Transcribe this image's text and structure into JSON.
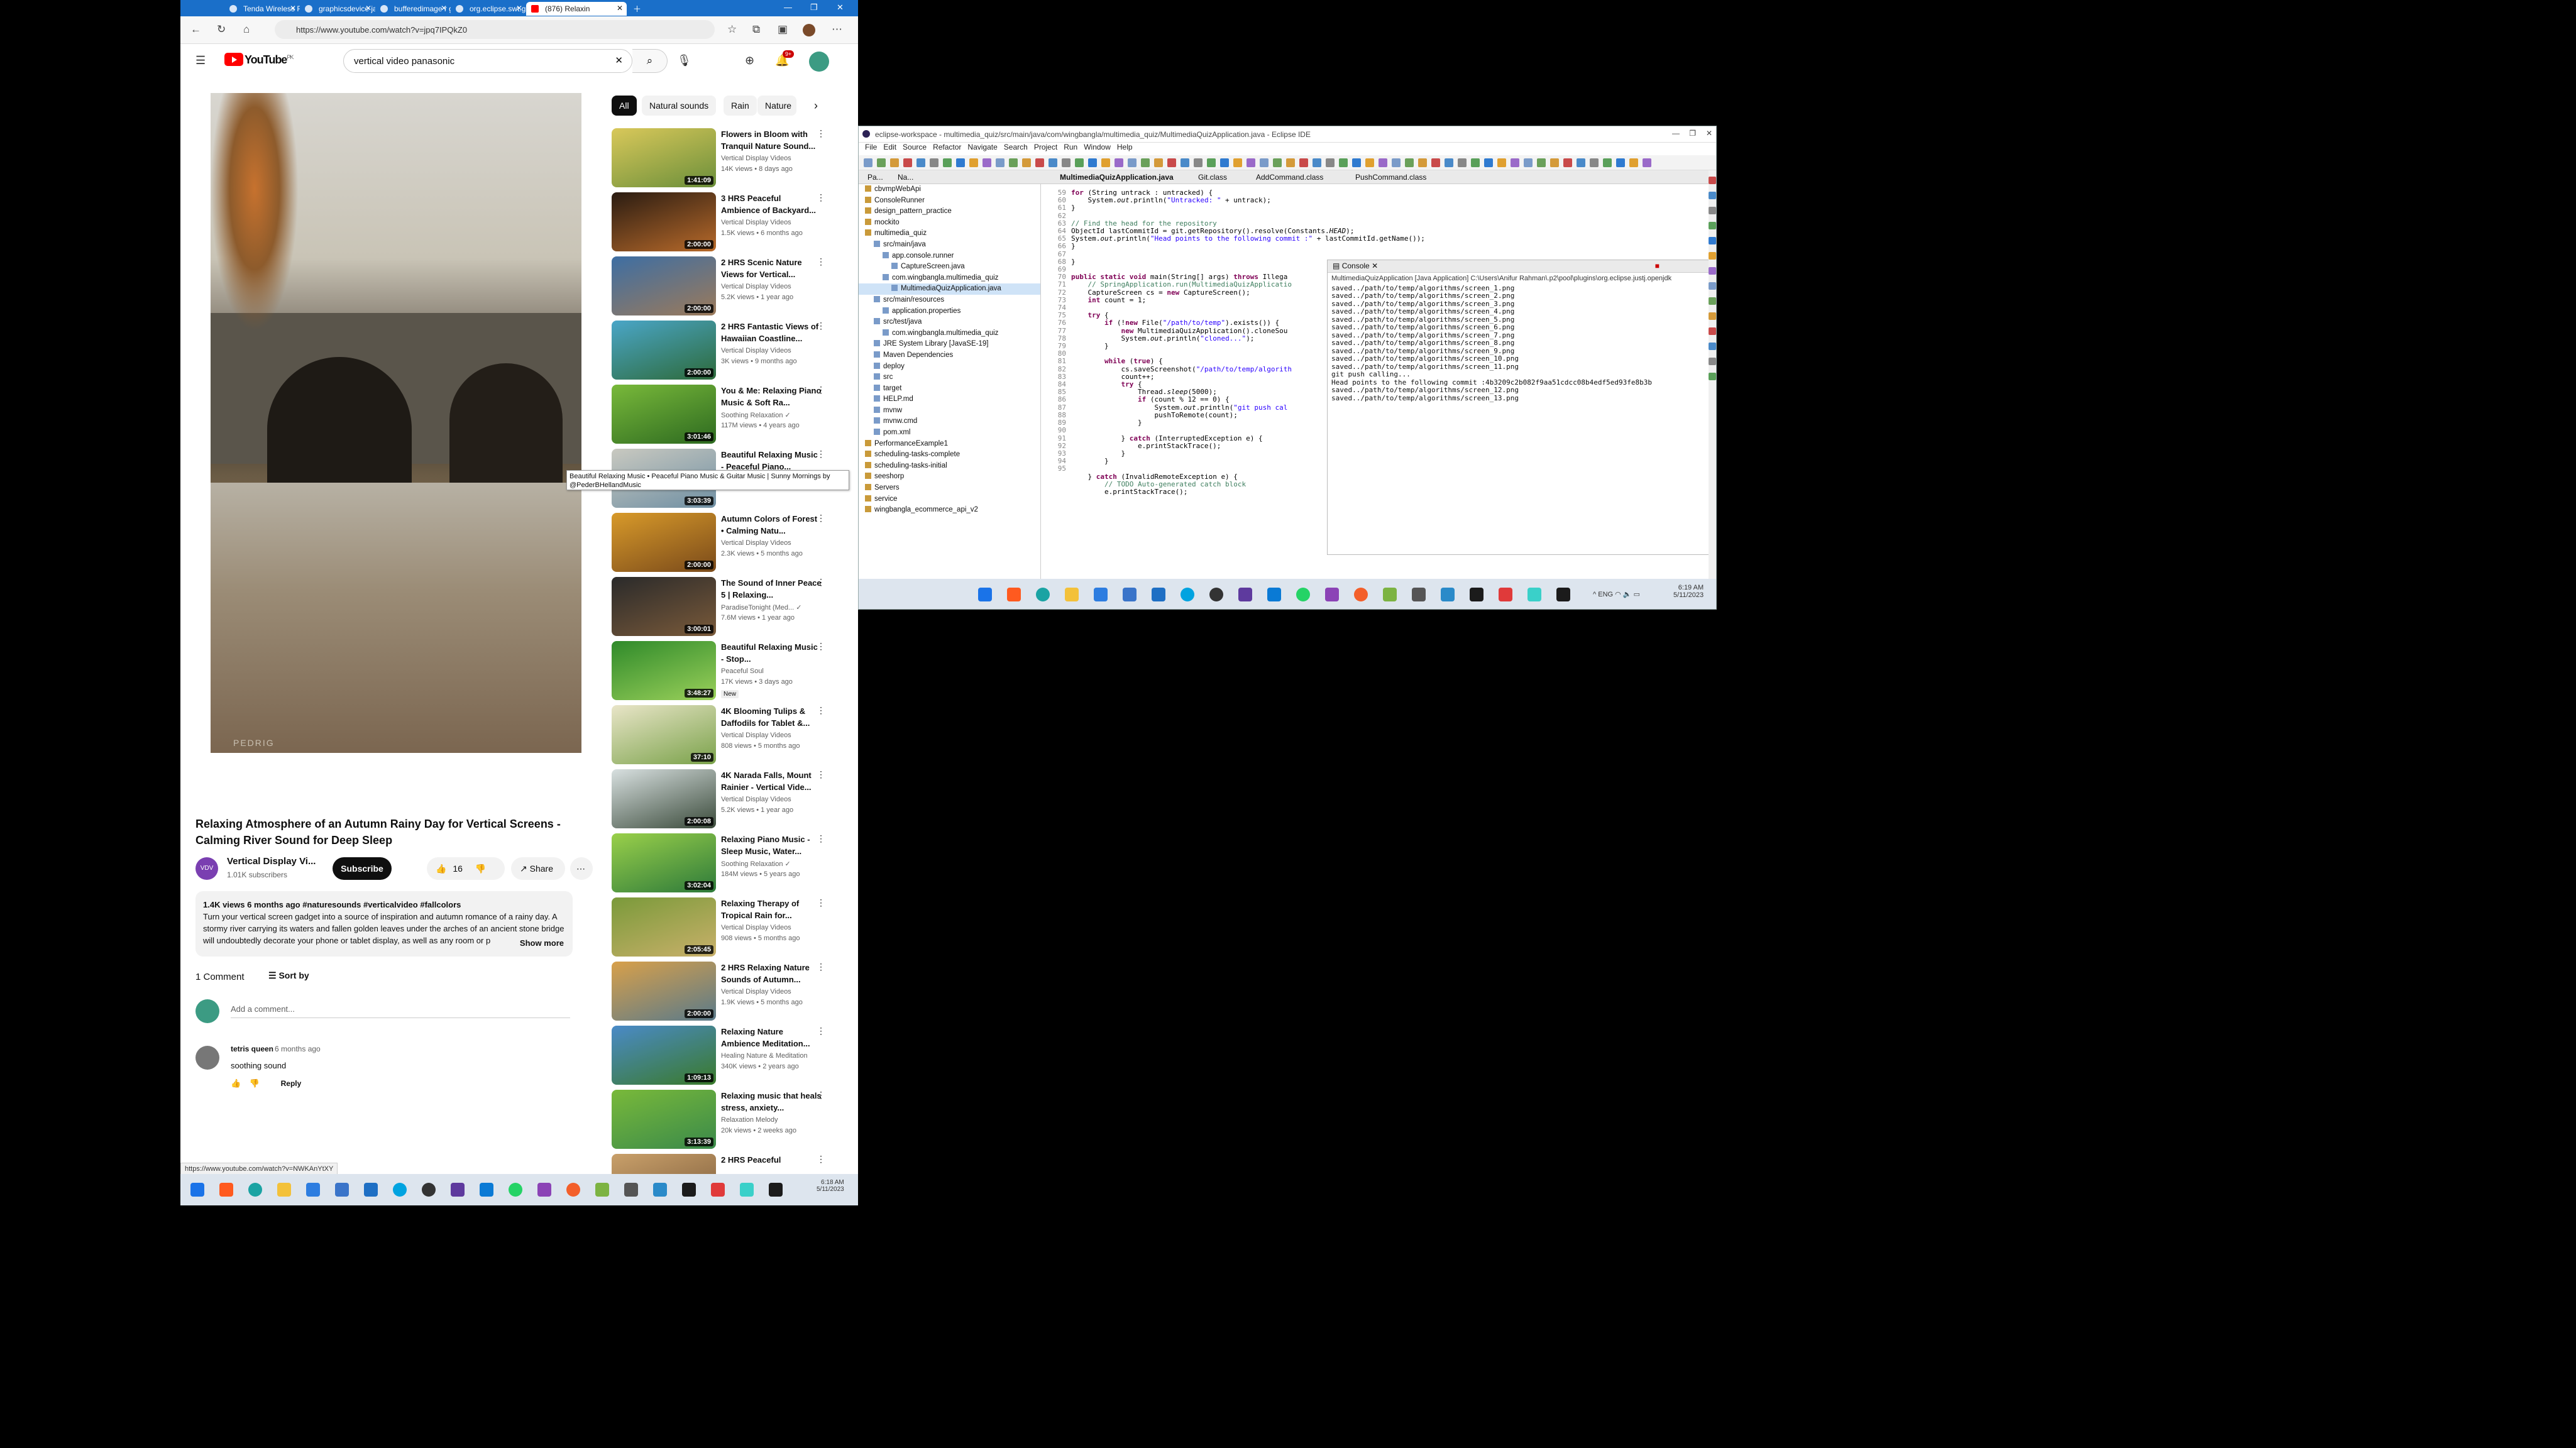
{
  "browser": {
    "tabs": [
      {
        "label": "Tenda Wireless R"
      },
      {
        "label": "graphicsdevice ja"
      },
      {
        "label": "bufferedimage r g"
      },
      {
        "label": "org.eclipse.swt.gr"
      },
      {
        "label": "(876) Relaxin"
      }
    ],
    "url": "https://www.youtube.com/watch?v=jpq7IPQkZ0",
    "status_url": "https://www.youtube.com/watch?v=NWKAnYtXY"
  },
  "youtube": {
    "logo": "YouTube",
    "logo_sup": "PK",
    "search_value": "vertical video panasonic",
    "notif_count": "9+",
    "chips": [
      "All",
      "Natural sounds",
      "Rain",
      "Nature"
    ],
    "video": {
      "title": "Relaxing Atmosphere of an Autumn Rainy Day for Vertical Screens - Calming River Sound for Deep Sleep",
      "channel": "Vertical Display Vi...",
      "channel_avatar": "VDV",
      "subs": "1.01K subscribers",
      "subscribe": "Subscribe",
      "likes": "16",
      "share": "Share",
      "watermark": "PEDRIG",
      "desc_meta": "1.4K views  6 months ago  #naturesounds #verticalvideo #fallcolors",
      "desc_text": "Turn your vertical screen gadget into a source of inspiration and autumn romance of a rainy day. A stormy river carrying its waters and fallen golden leaves under the arches of an ancient stone bridge will undoubtedly decorate your phone or tablet display, as well as any room or p",
      "show_more": "Show more"
    },
    "comments": {
      "count": "1 Comment",
      "sort": "Sort by",
      "add_placeholder": "Add a comment...",
      "items": [
        {
          "author": "tetris queen",
          "time": "6 months ago",
          "text": "soothing sound",
          "reply": "Reply"
        }
      ]
    },
    "tooltip": "Beautiful Relaxing Music • Peaceful Piano Music & Guitar Music | Sunny Mornings by @PederBHellandMusic",
    "recs": [
      {
        "title": "Flowers in Bloom with Tranquil Nature Sound...",
        "channel": "Vertical Display Videos",
        "meta": "14K views • 8 days ago",
        "duration": "1:41:09",
        "c1": "#d9c85a",
        "c2": "#6b8f3a"
      },
      {
        "title": "3 HRS Peaceful Ambience of Backyard...",
        "channel": "Vertical Display Videos",
        "meta": "1.5K views • 6 months ago",
        "duration": "2:00:00",
        "c1": "#2a1c12",
        "c2": "#b86a2a"
      },
      {
        "title": "2 HRS Scenic Nature Views for Vertical...",
        "channel": "Vertical Display Videos",
        "meta": "5.2K views • 1 year ago",
        "duration": "2:00:00",
        "c1": "#3d6ea3",
        "c2": "#9c7a5a"
      },
      {
        "title": "2 HRS Fantastic Views of Hawaiian Coastline...",
        "channel": "Vertical Display Videos",
        "meta": "3K views • 9 months ago",
        "duration": "2:00:00",
        "c1": "#4aa6c8",
        "c2": "#2d6a3a"
      },
      {
        "title": "You & Me: Relaxing Piano Music & Soft Ra...",
        "channel": "Soothing Relaxation ✓",
        "meta": "117M views • 4 years ago",
        "duration": "3:01:46",
        "c1": "#79b93a",
        "c2": "#2d6a20"
      },
      {
        "title": "Beautiful Relaxing Music - Peaceful Piano...",
        "channel": "Peder B. Helland ✓",
        "meta": "",
        "duration": "3:03:39",
        "c1": "#c9c9c0",
        "c2": "#6f8fa3"
      },
      {
        "title": "Autumn Colors of Forest • Calming Natu...",
        "channel": "Vertical Display Videos",
        "meta": "2.3K views • 5 months ago",
        "duration": "2:00:00",
        "c1": "#d89a2a",
        "c2": "#7a4a1a"
      },
      {
        "title": "The Sound of Inner Peace 5 | Relaxing...",
        "channel": "ParadiseTonight (Med... ✓",
        "meta": "7.6M views • 1 year ago",
        "duration": "3:00:01",
        "c1": "#2a2a2a",
        "c2": "#7a5a3a"
      },
      {
        "title": "Beautiful Relaxing Music - Stop...",
        "channel": "Peaceful Soul",
        "meta": "17K views • 3 days ago",
        "duration": "3:48:27",
        "badge": "New",
        "c1": "#2f8a2a",
        "c2": "#9ad05a"
      },
      {
        "title": "4K Blooming Tulips & Daffodils for Tablet &...",
        "channel": "Vertical Display Videos",
        "meta": "808 views • 5 months ago",
        "duration": "37:10",
        "c1": "#e9e5c8",
        "c2": "#7aa24a"
      },
      {
        "title": "4K Narada Falls, Mount Rainier - Vertical Vide...",
        "channel": "Vertical Display Videos",
        "meta": "5.2K views • 1 year ago",
        "duration": "2:00:08",
        "c1": "#d8e0e0",
        "c2": "#3a4a3a"
      },
      {
        "title": "Relaxing Piano Music - Sleep Music, Water...",
        "channel": "Soothing Relaxation ✓",
        "meta": "184M views • 5 years ago",
        "duration": "3:02:04",
        "c1": "#9ad04a",
        "c2": "#2d7a3a"
      },
      {
        "title": "Relaxing Therapy of Tropical Rain for...",
        "channel": "Vertical Display Videos",
        "meta": "908 views • 5 months ago",
        "duration": "2:05:45",
        "c1": "#7a9a3a",
        "c2": "#c9b06a"
      },
      {
        "title": "2 HRS Relaxing Nature Sounds of Autumn...",
        "channel": "Vertical Display Videos",
        "meta": "1.9K views • 5 months ago",
        "duration": "2:00:00",
        "c1": "#d8a04a",
        "c2": "#5a7a8a"
      },
      {
        "title": "Relaxing Nature Ambience Meditation...",
        "channel": "Healing Nature & Meditation",
        "meta": "340K views • 2 years ago",
        "duration": "1:09:13",
        "c1": "#4a8ac8",
        "c2": "#3a7a2a"
      },
      {
        "title": "Relaxing music that heals stress, anxiety...",
        "channel": "Relaxation Melody",
        "meta": "20k views • 2 weeks ago",
        "duration": "3:13:39",
        "c1": "#79b93a",
        "c2": "#3a8a4a"
      },
      {
        "title": "2 HRS Peaceful",
        "channel": "",
        "meta": "",
        "duration": "",
        "c1": "#c9a06a",
        "c2": "#7a5a3a"
      }
    ]
  },
  "eclipse": {
    "title": "eclipse-workspace - multimedia_quiz/src/main/java/com/wingbangla/multimedia_quiz/MultimediaQuizApplication.java - Eclipse IDE",
    "menu": [
      "File",
      "Edit",
      "Source",
      "Refactor",
      "Navigate",
      "Search",
      "Project",
      "Run",
      "Window",
      "Help"
    ],
    "editor_tabs": [
      "MultimediaQuizApplication.java",
      "Git.class",
      "AddCommand.class",
      "PushCommand.class"
    ],
    "pkg_tabs": [
      "Pa...",
      "Na..."
    ],
    "tree": [
      {
        "indent": 0,
        "label": "cbvmpWebApi"
      },
      {
        "indent": 0,
        "label": "ConsoleRunner"
      },
      {
        "indent": 0,
        "label": "design_pattern_practice"
      },
      {
        "indent": 0,
        "label": "mockito"
      },
      {
        "indent": 0,
        "label": "multimedia_quiz"
      },
      {
        "indent": 1,
        "label": "src/main/java"
      },
      {
        "indent": 2,
        "label": "app.console.runner"
      },
      {
        "indent": 3,
        "label": "CaptureScreen.java"
      },
      {
        "indent": 2,
        "label": "com.wingbangla.multimedia_quiz"
      },
      {
        "indent": 3,
        "label": "MultimediaQuizApplication.java",
        "selected": true
      },
      {
        "indent": 1,
        "label": "src/main/resources"
      },
      {
        "indent": 2,
        "label": "application.properties"
      },
      {
        "indent": 1,
        "label": "src/test/java"
      },
      {
        "indent": 2,
        "label": "com.wingbangla.multimedia_quiz"
      },
      {
        "indent": 1,
        "label": "JRE System Library [JavaSE-19]"
      },
      {
        "indent": 1,
        "label": "Maven Dependencies"
      },
      {
        "indent": 1,
        "label": "deploy"
      },
      {
        "indent": 1,
        "label": "src"
      },
      {
        "indent": 1,
        "label": "target"
      },
      {
        "indent": 1,
        "label": "HELP.md"
      },
      {
        "indent": 1,
        "label": "mvnw"
      },
      {
        "indent": 1,
        "label": "mvnw.cmd"
      },
      {
        "indent": 1,
        "label": "pom.xml"
      },
      {
        "indent": 0,
        "label": "PerformanceExample1"
      },
      {
        "indent": 0,
        "label": "scheduling-tasks-complete"
      },
      {
        "indent": 0,
        "label": "scheduling-tasks-initial"
      },
      {
        "indent": 0,
        "label": "seeshorp"
      },
      {
        "indent": 0,
        "label": "Servers"
      },
      {
        "indent": 0,
        "label": "service"
      },
      {
        "indent": 0,
        "label": "wingbangla_ecommerce_api_v2"
      }
    ],
    "line_numbers": [
      "59",
      "60",
      "61",
      "62",
      "63",
      "64",
      "65",
      "66",
      "67",
      "68",
      "69",
      "70",
      "71",
      "72",
      "73",
      "74",
      "75",
      "76",
      "77",
      "78",
      "79",
      "80",
      "81",
      "82",
      "83",
      "84",
      "85",
      "86",
      "87",
      "88",
      "89",
      "90",
      "91",
      "92",
      "93",
      "94",
      "95"
    ],
    "console": {
      "title": "Console",
      "terminated": "MultimediaQuizApplication [Java Application] C:\\Users\\Anifur Rahman\\.p2\\pool\\plugins\\org.eclipse.justj.openjdk",
      "lines": [
        "saved../path/to/temp/algorithms/screen_1.png",
        "saved../path/to/temp/algorithms/screen_2.png",
        "saved../path/to/temp/algorithms/screen_3.png",
        "saved../path/to/temp/algorithms/screen_4.png",
        "saved../path/to/temp/algorithms/screen_5.png",
        "saved../path/to/temp/algorithms/screen_6.png",
        "saved../path/to/temp/algorithms/screen_7.png",
        "saved../path/to/temp/algorithms/screen_8.png",
        "saved../path/to/temp/algorithms/screen_9.png",
        "saved../path/to/temp/algorithms/screen_10.png",
        "saved../path/to/temp/algorithms/screen_11.png",
        "git push calling...",
        "Head points to the following commit :4b3209c2b082f9aa51cdcc08b4edf5ed93fe8b3b",
        "saved../path/to/temp/algorithms/screen_12.png",
        "saved../path/to/temp/algorithms/screen_13.png"
      ]
    }
  },
  "taskbar": {
    "lang": "ENG",
    "time": "6:19 AM",
    "date": "5/11/2023",
    "time2": "6:18 AM",
    "date2": "5/11/2023"
  }
}
